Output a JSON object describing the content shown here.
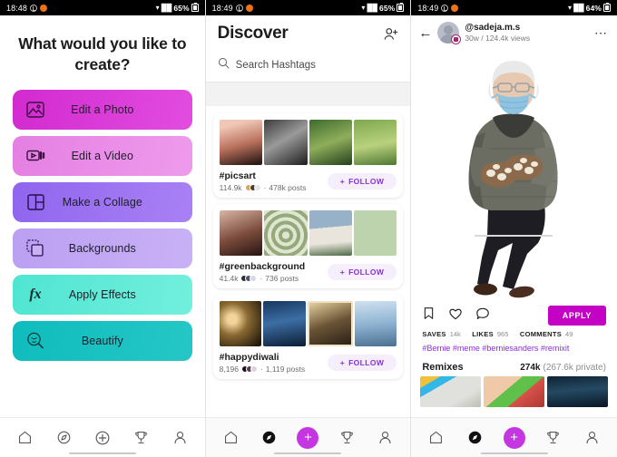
{
  "status_bars": [
    {
      "time": "18:48",
      "battery": "65%"
    },
    {
      "time": "18:49",
      "battery": "65%"
    },
    {
      "time": "18:49",
      "battery": "64%"
    }
  ],
  "create_panel": {
    "title": "What would you like to create?",
    "buttons": [
      {
        "label": "Edit a Photo",
        "icon": "image-icon",
        "color": "#d72bd3"
      },
      {
        "label": "Edit a Video",
        "icon": "video-camera-icon",
        "color": "#e981e6"
      },
      {
        "label": "Make a Collage",
        "icon": "collage-grid-icon",
        "color": "#9b6cf0"
      },
      {
        "label": "Backgrounds",
        "icon": "layers-icon",
        "color": "#c0a5f3"
      },
      {
        "label": "Apply Effects",
        "icon": "fx-icon",
        "color": "#5de8d4"
      },
      {
        "label": "Beautify",
        "icon": "beautify-face-icon",
        "color": "#13bfc0"
      }
    ]
  },
  "discover_panel": {
    "title": "Discover",
    "add_friend_icon": "add-person-icon",
    "search": {
      "placeholder": "Search Hashtags",
      "icon": "search-icon"
    },
    "hashtags": [
      {
        "name": "#picsart",
        "followers": "114.9k",
        "posts": "478k posts",
        "follow_label": "FOLLOW",
        "separator": "·"
      },
      {
        "name": "#greenbackground",
        "followers": "41.4k",
        "posts": "736 posts",
        "follow_label": "FOLLOW",
        "separator": "·"
      },
      {
        "name": "#happydiwali",
        "followers": "8,196",
        "posts": "1,119 posts",
        "follow_label": "FOLLOW",
        "separator": "·"
      }
    ]
  },
  "post_panel": {
    "back_icon": "back-arrow-icon",
    "username": "@sadeja.m.s",
    "meta": "30w / 124.4k views",
    "more_icon": "more-options-icon",
    "image_alt": "bernie-sanders-mittens-cutout",
    "actions": [
      {
        "icon": "bookmark-icon"
      },
      {
        "icon": "heart-icon"
      },
      {
        "icon": "comment-icon"
      }
    ],
    "apply_label": "APPLY",
    "stats": [
      {
        "key": "SAVES",
        "value": "14k"
      },
      {
        "key": "LIKES",
        "value": "965"
      },
      {
        "key": "COMMENTS",
        "value": "49"
      }
    ],
    "stats_separator": "·",
    "tags": "#Bernie #meme #berniesanders #remixit",
    "remixes": {
      "title": "Remixes",
      "count": "274k",
      "private": "(267.6k private)"
    }
  },
  "nav_bars": {
    "panel1": [
      {
        "icon": "home-icon",
        "active": false
      },
      {
        "icon": "compass-icon",
        "active": false
      },
      {
        "icon": "plus-circle-icon",
        "active": false
      },
      {
        "icon": "trophy-icon",
        "active": false
      },
      {
        "icon": "person-icon",
        "active": false
      }
    ],
    "panel2": [
      {
        "icon": "home-icon",
        "active": false
      },
      {
        "icon": "compass-filled-icon",
        "active": true
      },
      {
        "icon": "plus-filled-icon",
        "active": true
      },
      {
        "icon": "trophy-icon",
        "active": false
      },
      {
        "icon": "person-icon",
        "active": false
      }
    ],
    "panel3": [
      {
        "icon": "home-icon",
        "active": false
      },
      {
        "icon": "compass-filled-icon",
        "active": true
      },
      {
        "icon": "plus-filled-icon",
        "active": true
      },
      {
        "icon": "trophy-icon",
        "active": false
      },
      {
        "icon": "person-icon",
        "active": false
      }
    ],
    "plus_glyph": "+"
  },
  "colors": {
    "accent_magenta": "#c400c4",
    "accent_purple": "#8d2ce0",
    "nav_plus": "#c336e0"
  }
}
